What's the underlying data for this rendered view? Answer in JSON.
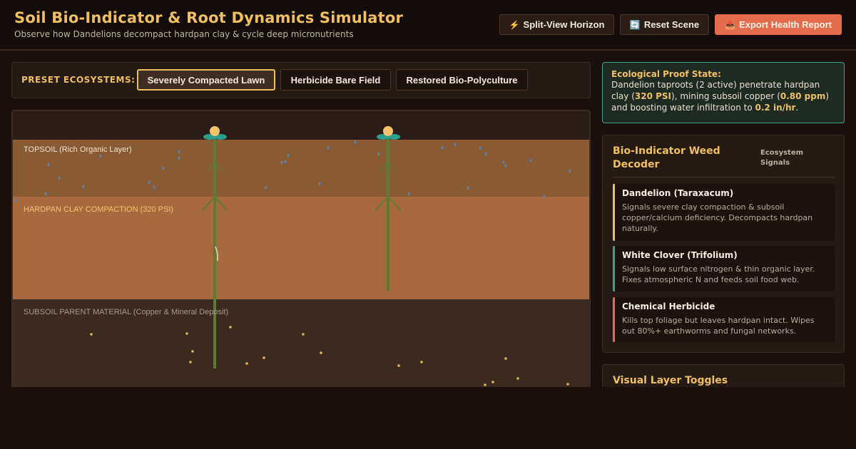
{
  "header": {
    "title": "Soil Bio-Indicator & Root Dynamics Simulator",
    "subtitle": "Observe how Dandelions decompact hardpan clay & cycle deep micronutrients",
    "buttons": [
      {
        "icon": "⚡",
        "icon_name": "lightning-icon",
        "label": "Split-View Horizon"
      },
      {
        "icon": "🔄",
        "icon_name": "refresh-icon",
        "label": "Reset Scene"
      },
      {
        "icon": "📤",
        "icon_name": "export-icon",
        "label": "Export Health Report"
      }
    ]
  },
  "presets": {
    "label": "PRESET ECOSYSTEMS:",
    "items": [
      "Severely Compacted Lawn",
      "Herbicide Bare Field",
      "Restored Bio-Polyculture"
    ],
    "active_index": 0
  },
  "scene": {
    "layers": [
      {
        "label": "TOPSOIL (Rich Organic Layer)",
        "color": "#8a5a32"
      },
      {
        "label": "HARDPAN CLAY COMPACTION (320 PSI)",
        "color": "#a8693e"
      },
      {
        "label": "SUBSOIL PARENT MATERIAL (Copper & Mineral Deposit)",
        "color": "#3a2a1f"
      }
    ],
    "plants": 2
  },
  "proof": {
    "title": "Ecological Proof State:",
    "text_1": "Dandelion taproots (2 active) penetrate hardpan clay (",
    "psi": "320 PSI",
    "text_2": "), mining subsoil copper (",
    "ppm": "0.80 ppm",
    "text_3": ") and boosting water infiltration to ",
    "rate": "0.2 in/hr",
    "text_4": "."
  },
  "decoder": {
    "title": "Bio-Indicator Weed Decoder",
    "signals_label": "Ecosystem Signals",
    "cards": [
      {
        "title": "Dandelion (Taraxacum)",
        "desc": "Signals severe clay compaction & subsoil copper/calcium deficiency. Decompacts hardpan naturally.",
        "color": "#f0c060"
      },
      {
        "title": "White Clover (Trifolium)",
        "desc": "Signals low surface nitrogen & thin organic layer. Fixes atmospheric N and feeds soil food web.",
        "color": "#3da38b"
      },
      {
        "title": "Chemical Herbicide",
        "desc": "Kills top foliage but leaves hardpan intact. Wipes out 80%+ earthworms and fungal networks.",
        "color": "#e46c4d"
      }
    ]
  },
  "toggles": {
    "title": "Visual Layer Toggles"
  }
}
